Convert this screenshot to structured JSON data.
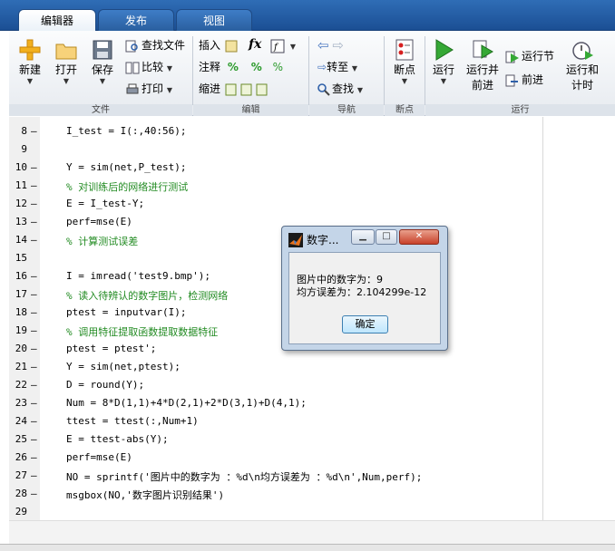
{
  "tabs": [
    {
      "label": "编辑器",
      "active": true
    },
    {
      "label": "发布",
      "active": false
    },
    {
      "label": "视图",
      "active": false
    }
  ],
  "ribbon": {
    "new_label": "新建",
    "open_label": "打开",
    "save_label": "保存",
    "find_files_label": "查找文件",
    "compare_label": "比较",
    "print_label": "打印",
    "insert_label": "插入",
    "comment_label": "注释",
    "indent_label": "缩进",
    "fx_label": "fx",
    "goto_label": "转至",
    "find_label": "查找",
    "breakpoints_label": "断点",
    "run_label": "运行",
    "run_advance_label_1": "运行并",
    "run_advance_label_2": "前进",
    "run_section_label": "运行节",
    "advance_label": "前进",
    "run_time_label_1": "运行和",
    "run_time_label_2": "计时",
    "group_file": "文件",
    "group_edit": "编辑",
    "group_nav": "导航",
    "group_breakpoints": "断点",
    "group_run": "运行"
  },
  "code_lines": [
    {
      "n": "8",
      "text": "I_test = I(:,40:56);"
    },
    {
      "n": "9",
      "text": ""
    },
    {
      "n": "10",
      "text": "Y = sim(net,P_test);"
    },
    {
      "n": "11",
      "text": "% 对训练后的网络进行测试"
    },
    {
      "n": "12",
      "text": "E = I_test-Y;"
    },
    {
      "n": "13",
      "text": "perf=mse(E)"
    },
    {
      "n": "14",
      "text": "% 计算测试误差"
    },
    {
      "n": "15",
      "text": ""
    },
    {
      "n": "16",
      "text": "I = imread('test9.bmp');"
    },
    {
      "n": "17",
      "text": "% 读入待辨认的数字图片，检测网络"
    },
    {
      "n": "18",
      "text": "ptest = inputvar(I);"
    },
    {
      "n": "19",
      "text": "% 调用特征提取函数提取数据特征"
    },
    {
      "n": "20",
      "text": "ptest = ptest';"
    },
    {
      "n": "21",
      "text": "Y = sim(net,ptest);"
    },
    {
      "n": "22",
      "text": "D = round(Y);"
    },
    {
      "n": "23",
      "text": "Num = 8*D(1,1)+4*D(2,1)+2*D(3,1)+D(4,1);"
    },
    {
      "n": "24",
      "text": "ttest = ttest(:,Num+1)"
    },
    {
      "n": "25",
      "text": "E = ttest-abs(Y);"
    },
    {
      "n": "26",
      "text": "perf=mse(E)"
    },
    {
      "n": "27",
      "text": "NO = sprintf('图片中的数字为 ：%d\\n均方误差为 ：%d\\n',Num,perf);"
    },
    {
      "n": "28",
      "text": "msgbox(NO,'数字图片识别结果')"
    },
    {
      "n": "29",
      "text": ""
    }
  ],
  "dialog": {
    "title": "数字...",
    "line1": "图片中的数字为：9",
    "line2": "均方误差为：2.104299e-12",
    "ok_label": "确定"
  }
}
